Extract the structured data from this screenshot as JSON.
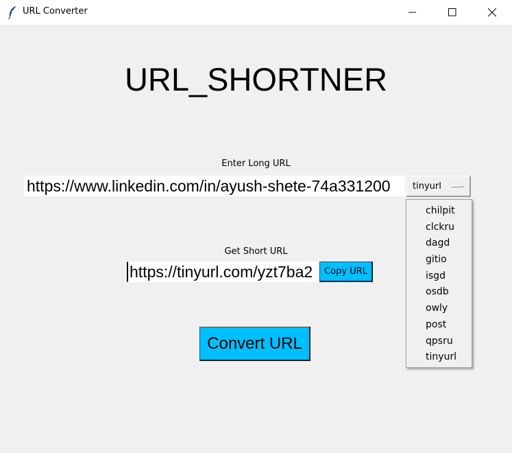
{
  "window": {
    "title": "URL Converter",
    "icon": "feather-icon"
  },
  "main": {
    "heading": "URL_SHORTNER",
    "long_url_label": "Enter Long URL",
    "long_url_value": "https://www.linkedin.com/in/ayush-shete-74a331200",
    "short_url_label": "Get Short URL",
    "short_url_value": "https://tinyurl.com/yzt7ba2",
    "copy_button_label": "Copy URL",
    "convert_button_label": "Convert URL"
  },
  "service_menu": {
    "selected": "tinyurl",
    "options": [
      "chilpit",
      "clckru",
      "dagd",
      "gitio",
      "isgd",
      "osdb",
      "owly",
      "post",
      "qpsru",
      "tinyurl"
    ]
  },
  "colors": {
    "button_bg": "#00bfff",
    "window_bg": "#f0f0f0"
  }
}
